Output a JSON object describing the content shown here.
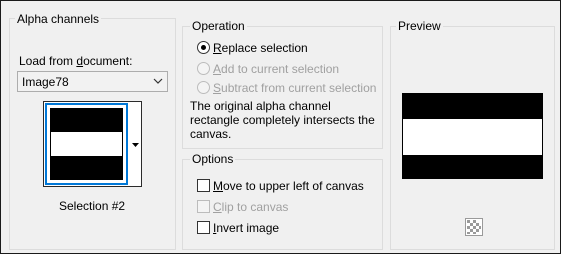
{
  "alpha_channels": {
    "title": "Alpha channels",
    "load_from_label_pre": "Load from ",
    "load_from_label_ul": "d",
    "load_from_label_post": "ocument:",
    "document_value": "Image78",
    "selection_caption": "Selection #2"
  },
  "operation": {
    "title": "Operation",
    "replace_ul": "R",
    "replace_rest": "eplace selection",
    "replace_selected": true,
    "add_ul": "A",
    "add_rest": "dd to current selection",
    "add_enabled": false,
    "subtract_ul": "S",
    "subtract_rest": "ubtract from current selection",
    "subtract_enabled": false,
    "message_line1": "The original alpha channel",
    "message_line2": "rectangle completely intersects the",
    "message_line3": "canvas."
  },
  "options": {
    "title": "Options",
    "move_ul": "M",
    "move_rest": "ove to upper left of canvas",
    "move_checked": false,
    "clip_ul": "C",
    "clip_rest": "lip to canvas",
    "clip_checked": false,
    "clip_enabled": false,
    "invert_ul": "I",
    "invert_rest": "nvert image",
    "invert_checked": false
  },
  "preview": {
    "title": "Preview",
    "icon": "transparency-checker-icon"
  },
  "colors": {
    "accent": "#0078d7",
    "stripe_dark": "#000000",
    "stripe_light": "#ffffff",
    "disabled_text": "#a0a0a0"
  }
}
